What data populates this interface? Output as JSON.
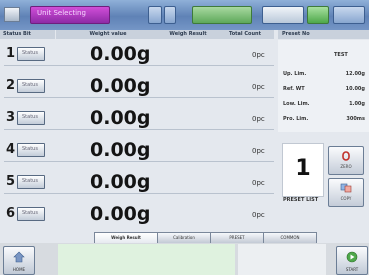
{
  "topbar": {
    "title": "Unit Selecting"
  },
  "headers": {
    "col1": "Status Bit",
    "col2": "Weight value",
    "col3": "Weigh Result",
    "col4": "Total Count",
    "col5": "Preset No"
  },
  "rows": [
    {
      "num": "1",
      "button": "Status",
      "value": "0.00g",
      "count": "0pc"
    },
    {
      "num": "2",
      "button": "Status",
      "value": "0.00g",
      "count": "0pc"
    },
    {
      "num": "3",
      "button": "Status",
      "value": "0.00g",
      "count": "0pc"
    },
    {
      "num": "4",
      "button": "Status",
      "value": "0.00g",
      "count": "0pc"
    },
    {
      "num": "5",
      "button": "Status",
      "value": "0.00g",
      "count": "0pc"
    },
    {
      "num": "6",
      "button": "Status",
      "value": "0.00g",
      "count": "0pc"
    }
  ],
  "preset_panel": {
    "title": "TEST",
    "fields": [
      {
        "label": "Up. Lim.",
        "value": "12.00g"
      },
      {
        "label": "Ref. WT",
        "value": "10.00g"
      },
      {
        "label": "Low. Lim.",
        "value": "1.00g"
      },
      {
        "label": "Pro. Lim.",
        "value": "300ms"
      }
    ],
    "preset_number": "1",
    "preset_list_label": "PRESET LIST"
  },
  "side_buttons": {
    "zero": "ZERO",
    "copy": "COPY"
  },
  "tabs": [
    {
      "label": "Weigh Result",
      "active": true
    },
    {
      "label": "Calibration",
      "active": false
    },
    {
      "label": "PRESET",
      "active": false
    },
    {
      "label": "COMMON",
      "active": false
    }
  ],
  "bottom": {
    "home": "HOME",
    "start": "START"
  },
  "colors": {
    "topbar": "#6b8cc0",
    "title_tab": "#b03cc0",
    "green_area": "#dff2df"
  }
}
